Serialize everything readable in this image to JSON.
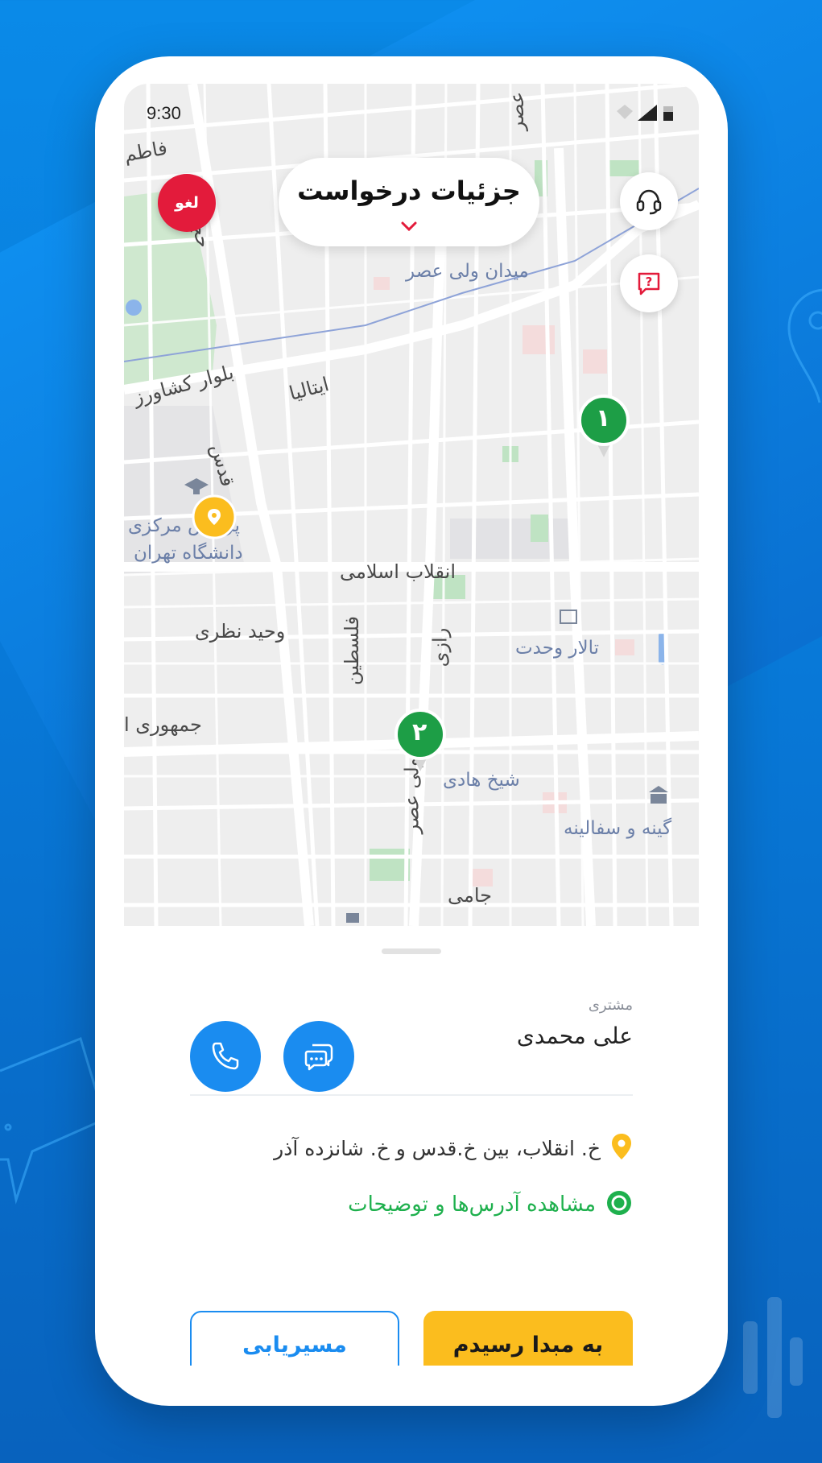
{
  "status_bar": {
    "time": "9:30"
  },
  "header": {
    "title": "جزئیات درخواست",
    "cancel_label": "لغو"
  },
  "map": {
    "labels": {
      "fatemi": "فاطم",
      "hejab": "حجاب",
      "vali_asr_square": "میدان ولی عصر",
      "keshavarz": "بلوار کشاورز",
      "italia": "ایتالیا",
      "qods": "قدس",
      "university_1": "پردیس مرکزی",
      "university_2": "دانشگاه تهران",
      "enghelab": "انقلاب اسلامی",
      "vahid_nazari": "وحید نظری",
      "felestin": "فلسطین",
      "razi": "رازی",
      "talar_vahdat": "تالار وحدت",
      "jomhouri": "جمهوری ا",
      "sheikh_hadi": "شیخ هادی",
      "vali_asr_street": "ولی عصر",
      "glass_museum": "گینه و سفالینه",
      "jami": "جامی",
      "vali_asr_top": "عصر"
    },
    "markers": {
      "origin_1": "۱",
      "origin_2": "۲"
    }
  },
  "sheet": {
    "customer_caption": "مشتری",
    "customer_name": "علی محمدی",
    "address": "خ. انقلاب، بین خ.قدس و خ. شانزده آذر",
    "view_addresses_link": "مشاهده آدرس‌ها و توضیحات",
    "arrived_button": "به مبدا رسیدم",
    "navigate_button": "مسیریابی"
  },
  "colors": {
    "primary_blue": "#1a8cf0",
    "accent_yellow": "#fbbd1e",
    "cancel_red": "#e31b3b",
    "success_green": "#1eb04d"
  },
  "icons": {
    "support": "headset-icon",
    "help": "question-chat-icon",
    "call": "phone-icon",
    "chat": "chat-icon",
    "origin": "location-pin-icon",
    "destination": "target-icon"
  }
}
